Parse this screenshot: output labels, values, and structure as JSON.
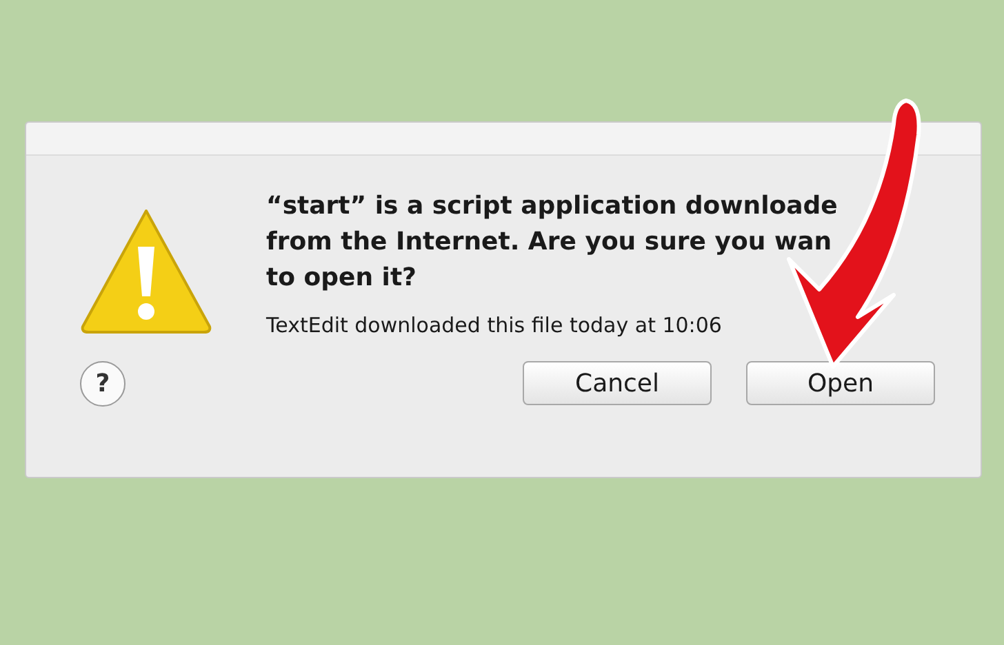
{
  "dialog": {
    "message_lines": [
      "“start” is a script application downloade",
      "from the Internet. Are you sure you wan",
      "to open it?"
    ],
    "info": "TextEdit downloaded this file today at 10:06",
    "help": "?",
    "buttons": [
      {
        "label": "Cancel"
      },
      {
        "label": "Open"
      }
    ]
  }
}
